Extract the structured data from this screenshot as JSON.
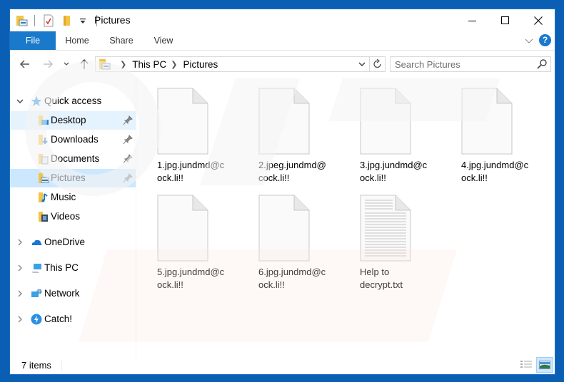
{
  "window": {
    "title": "Pictures",
    "controls": {
      "minimize": "minimize",
      "maximize": "maximize",
      "close": "close"
    }
  },
  "quick_access_toolbar": {
    "icons": [
      "folder-picture-icon",
      "properties-checkmark-icon",
      "new-folder-icon",
      "customize-dropdown-icon"
    ]
  },
  "ribbon": {
    "tabs": [
      {
        "label": "File",
        "active": true
      },
      {
        "label": "Home"
      },
      {
        "label": "Share"
      },
      {
        "label": "View"
      }
    ],
    "help_label": "?"
  },
  "address_bar": {
    "breadcrumbs": [
      "This PC",
      "Pictures"
    ]
  },
  "search": {
    "placeholder": "Search Pictures",
    "value": ""
  },
  "sidebar": {
    "quick_access": {
      "label": "Quick access",
      "items": [
        {
          "label": "Desktop",
          "pinned": true,
          "state": "hover"
        },
        {
          "label": "Downloads",
          "pinned": true
        },
        {
          "label": "Documents",
          "pinned": true
        },
        {
          "label": "Pictures",
          "pinned": true,
          "state": "selected"
        },
        {
          "label": "Music",
          "pinned": false
        },
        {
          "label": "Videos",
          "pinned": false
        }
      ]
    },
    "roots": [
      {
        "label": "OneDrive",
        "icon": "onedrive-cloud-icon"
      },
      {
        "label": "This PC",
        "icon": "computer-icon"
      },
      {
        "label": "Network",
        "icon": "network-icon"
      },
      {
        "label": "Catch!",
        "icon": "catch-lightning-icon"
      }
    ]
  },
  "files": [
    {
      "name": "1.jpg.jundmd@cock.li!!",
      "line1": "1.jpg.jundmd@c",
      "line2": "ock.li!!",
      "type": "blank"
    },
    {
      "name": "2.jpeg.jundmd@cock.li!!",
      "line1": "2.jpeg.jundmd@",
      "line2": "cock.li!!",
      "type": "blank"
    },
    {
      "name": "3.jpg.jundmd@cock.li!!",
      "line1": "3.jpg.jundmd@c",
      "line2": "ock.li!!",
      "type": "blank"
    },
    {
      "name": "4.jpg.jundmd@cock.li!!",
      "line1": "4.jpg.jundmd@c",
      "line2": "ock.li!!",
      "type": "blank"
    },
    {
      "name": "5.jpg.jundmd@cock.li!!",
      "line1": "5.jpg.jundmd@c",
      "line2": "ock.li!!",
      "type": "blank"
    },
    {
      "name": "6.jpg.jundmd@cock.li!!",
      "line1": "6.jpg.jundmd@c",
      "line2": "ock.li!!",
      "type": "blank"
    },
    {
      "name": "Help to decrypt.txt",
      "line1": "Help to",
      "line2": "decrypt.txt",
      "type": "text"
    }
  ],
  "status_bar": {
    "item_count": "7 items",
    "view_modes": [
      "details-view",
      "large-icons-view"
    ],
    "active_view": "large-icons-view"
  },
  "colors": {
    "accent": "#1979ca",
    "desktop_bg": "#0a5fb4",
    "selection": "#cce8ff",
    "hover": "#e5f3ff"
  }
}
